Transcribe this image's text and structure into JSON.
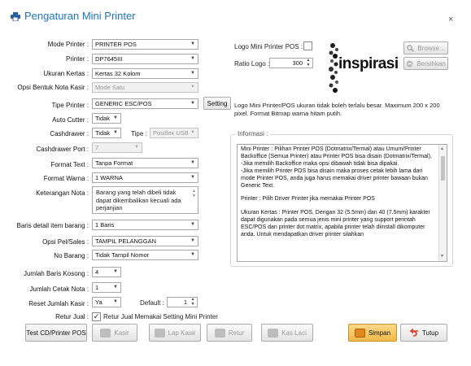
{
  "window": {
    "title": "Pengaturan Mini Printer",
    "close": "×"
  },
  "form": {
    "mode_printer": {
      "label": "Mode Printer :",
      "value": "PRINTER POS"
    },
    "printer": {
      "label": "Printer :",
      "value": "DP7645III"
    },
    "ukuran_kertas": {
      "label": "Ukuran Kertas :",
      "value": "Kertas 32 Kolom"
    },
    "opsi_bentuk_nota": {
      "label": "Opsi Bentuk Nota Kasir :",
      "value": "Mode Satu"
    },
    "tipe_printer": {
      "label": "Tipe Printer :",
      "value": "GENERIC ESC/POS",
      "setting_label": "Setting"
    },
    "auto_cutter": {
      "label": "Auto Cutter :",
      "value": "Tidak"
    },
    "cashdrawer": {
      "label": "Cashdrawer :",
      "value": "Tidak",
      "tipe_label": "Tipe :",
      "tipe_value": "Posiflex USB"
    },
    "cashdrawer_port": {
      "label": "Cashdrawer Port :",
      "value": "7"
    },
    "format_text": {
      "label": "Format Text :",
      "value": "Tanpa Format"
    },
    "format_warna": {
      "label": "Format Warna :",
      "value": "1 WARNA"
    },
    "keterangan_nota": {
      "label": "Keterangan Nota :",
      "value": "Barang yang telah dibeli tidak dapat dikembalikan kecuali ada perjanjian"
    },
    "baris_detail": {
      "label": "Baris detail item barang :",
      "value": "1 Baris"
    },
    "opsi_pel_sales": {
      "label": "Opsi Pel/Sales :",
      "value": "TAMPIL PELANGGAN"
    },
    "no_barang": {
      "label": "No Barang :",
      "value": "Tidak Tampil Nomor"
    },
    "jumlah_baris_kosong": {
      "label": "Jumlah Baris Kosong :",
      "value": "4"
    },
    "jumlah_cetak_nota": {
      "label": "Jumlah Cetak Nota :",
      "value": "1"
    },
    "reset_jumlah_kasir": {
      "label": "Reset Jumlah Kasir :",
      "value": "Ya",
      "default_label": "Default :",
      "default_value": "1"
    },
    "retur_jual": {
      "label": "Retur Jual :",
      "checkbox_label": "Retur Jual Memakai Setting Mini Printer",
      "checked": true
    }
  },
  "logo": {
    "checkbox_label": "Logo Mini Printer POS :",
    "checked": false,
    "ratio_label": "Ratio Logo :",
    "ratio_value": "300",
    "browse_label": "Browse...",
    "clear_label": "Bersihkan",
    "logo_text": "inspirasibiz",
    "note": "Logo Mini Printer/POS ukuran tidak boleh terlalu besar. Maximum 200 x 200 pixel. Format Bitmap warna hitam putih."
  },
  "informasi": {
    "legend": "Informasi :",
    "paragraphs": [
      "Mini Printer : Pilihan Printer POS (Dotmatrix/Termal) atau Umum/Printer Backoffice (Semua Printer) atau Printer POS bisa disain (Dotmatrix/Termal),\n-Jika memilih Backoffice maka opsi dibawah tidak bisa dipakai.\n-Jika memilih Printer POS bisa disain maka proses cetak lebih lama dari mode Printer POS, anda juga harus memakai driver printer bawaan bukan Generic Text.",
      "Printer : Pilih Driver Printer jika memakai Printer POS",
      "Ukuran Kertas : Printer POS, Dengan 32 (5.5mm) dan 40 (7.5mm) karakter dapat digunakan pada semua jenis mini printer yang support perintah ESC/POS dan printer dot matrix, apabila printer telah diinstall dikomputer anda. Untuk mendapatkan driver printer silahkan"
    ]
  },
  "buttons": {
    "test": "Test CD/Printer POS",
    "kasir": "Kasir",
    "lap_kasir": "Lap Kasir",
    "retur": "Retur",
    "kas_laci": "Kas Laci",
    "simpan": "Simpan",
    "tutup": "Tutup"
  },
  "colors": {
    "title": "#1e73c0",
    "simpan_bg": "#f3c35a",
    "tutup_icon": "#d93b2b"
  }
}
